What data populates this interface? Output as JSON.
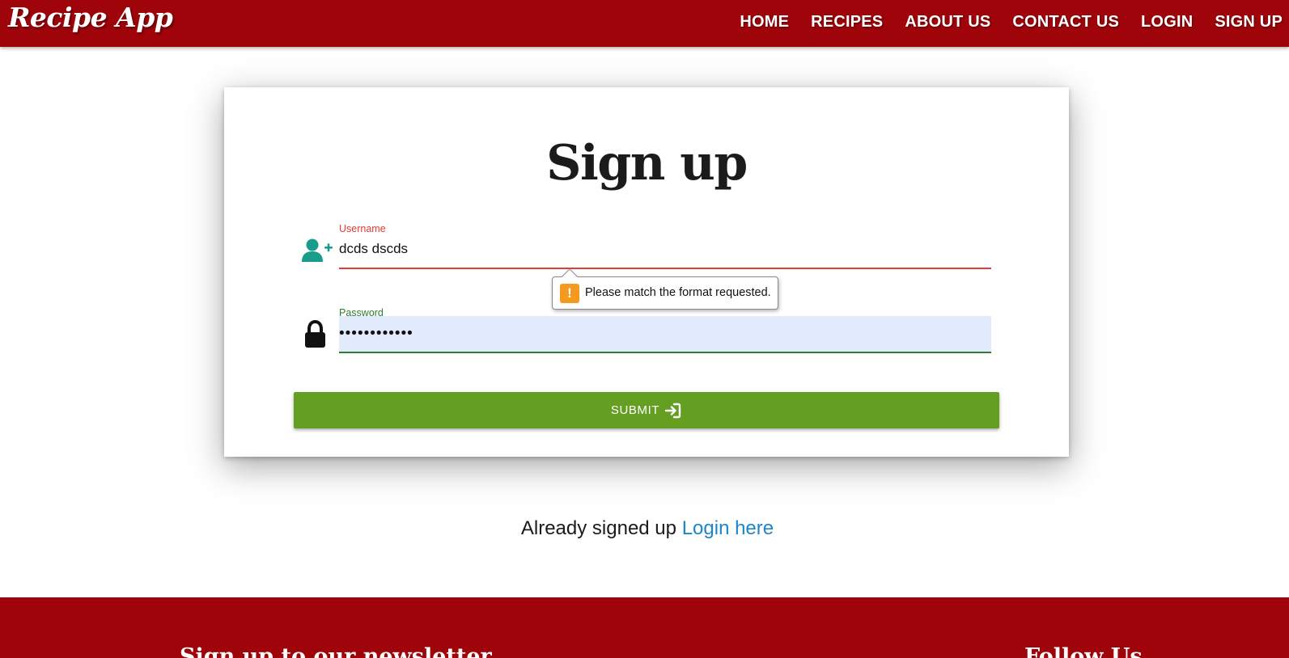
{
  "navbar": {
    "brand": "Recipe App",
    "links": [
      "HOME",
      "RECIPES",
      "ABOUT US",
      "CONTACT US",
      "LOGIN",
      "SIGN UP"
    ]
  },
  "form": {
    "title": "Sign up",
    "username": {
      "label": "Username",
      "value": "dcds dscds",
      "icon": "user-plus-icon",
      "status_color": "#e53935"
    },
    "password": {
      "label": "Password",
      "value": "••••••••••••",
      "icon": "lock-icon",
      "status_color": "#2e7d32"
    },
    "validation_message": "Please match the format requested.",
    "submit_label": "SUBMIT"
  },
  "already_signed_up": {
    "text": "Already signed up",
    "link": "Login here"
  },
  "footer": {
    "newsletter_heading": "Sign up to our newsletter",
    "follow_heading": "Follow Us"
  },
  "colors": {
    "brand": "#9e040a",
    "submit": "#659f22",
    "link": "#1b86c9",
    "icon_teal": "#1a9c8c"
  }
}
